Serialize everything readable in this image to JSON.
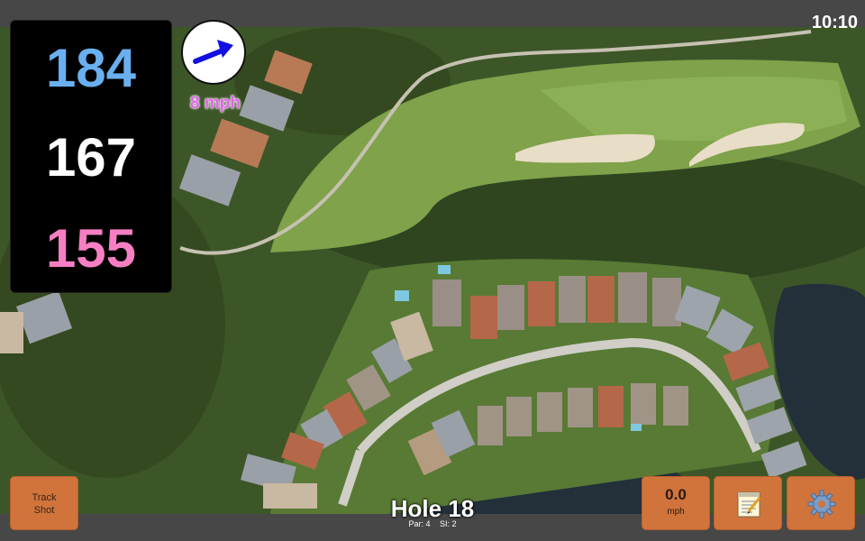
{
  "status": {
    "time": "10:10"
  },
  "distances": {
    "back": "184",
    "middle": "167",
    "front": "155"
  },
  "wind": {
    "speed": "8 mph"
  },
  "buttons": {
    "track_shot": {
      "line1": "Track",
      "line2": "Shot"
    },
    "speed": {
      "value": "0.0",
      "unit": "mph"
    }
  },
  "hole": {
    "title": "Hole 18",
    "par": "Par: 4",
    "si": "SI: 2"
  },
  "icons": {
    "wind_arrow": "arrow-right-up-icon",
    "notes": "notepad-icon",
    "settings": "gear-icon"
  },
  "colors": {
    "back_distance": "#6ab0f0",
    "middle_distance": "#ffffff",
    "front_distance": "#f67fc3",
    "wind_text": "#e066e8",
    "button": "#d0743c",
    "wind_arrow": "#1010e0"
  }
}
